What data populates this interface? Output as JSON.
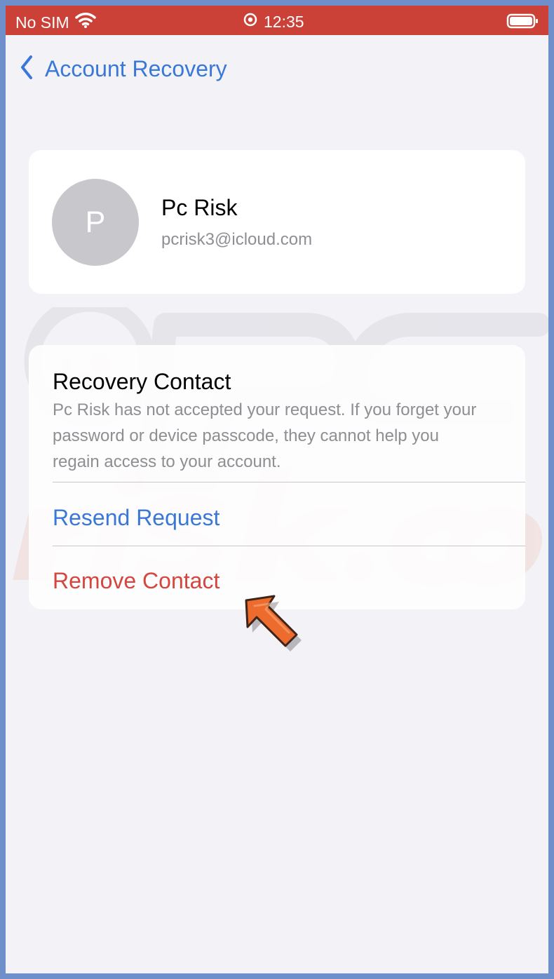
{
  "status_bar": {
    "carrier": "No SIM",
    "time": "12:35"
  },
  "navigation": {
    "back_label": "Account Recovery"
  },
  "profile": {
    "initial": "P",
    "name": "Pc Risk",
    "email": "pcrisk3@icloud.com"
  },
  "recovery_contact": {
    "title": "Recovery Contact",
    "description": "Pc Risk has not accepted your request. If you forget your password or device passcode, they cannot help you regain access to your account.",
    "resend_label": "Resend Request",
    "remove_label": "Remove Contact"
  },
  "colors": {
    "status_bar": "#cc4137",
    "accent": "#3a78d8",
    "destructive": "#d4463e",
    "annotation_arrow": "#ec6b2d"
  },
  "icons": {
    "status": [
      "wifi-icon",
      "location-icon",
      "battery-icon"
    ],
    "navigation": "chevron-left-icon",
    "annotation": "pointer-arrow-icon"
  },
  "watermark": {
    "line_1": "PC",
    "line_2": "risk.com"
  }
}
